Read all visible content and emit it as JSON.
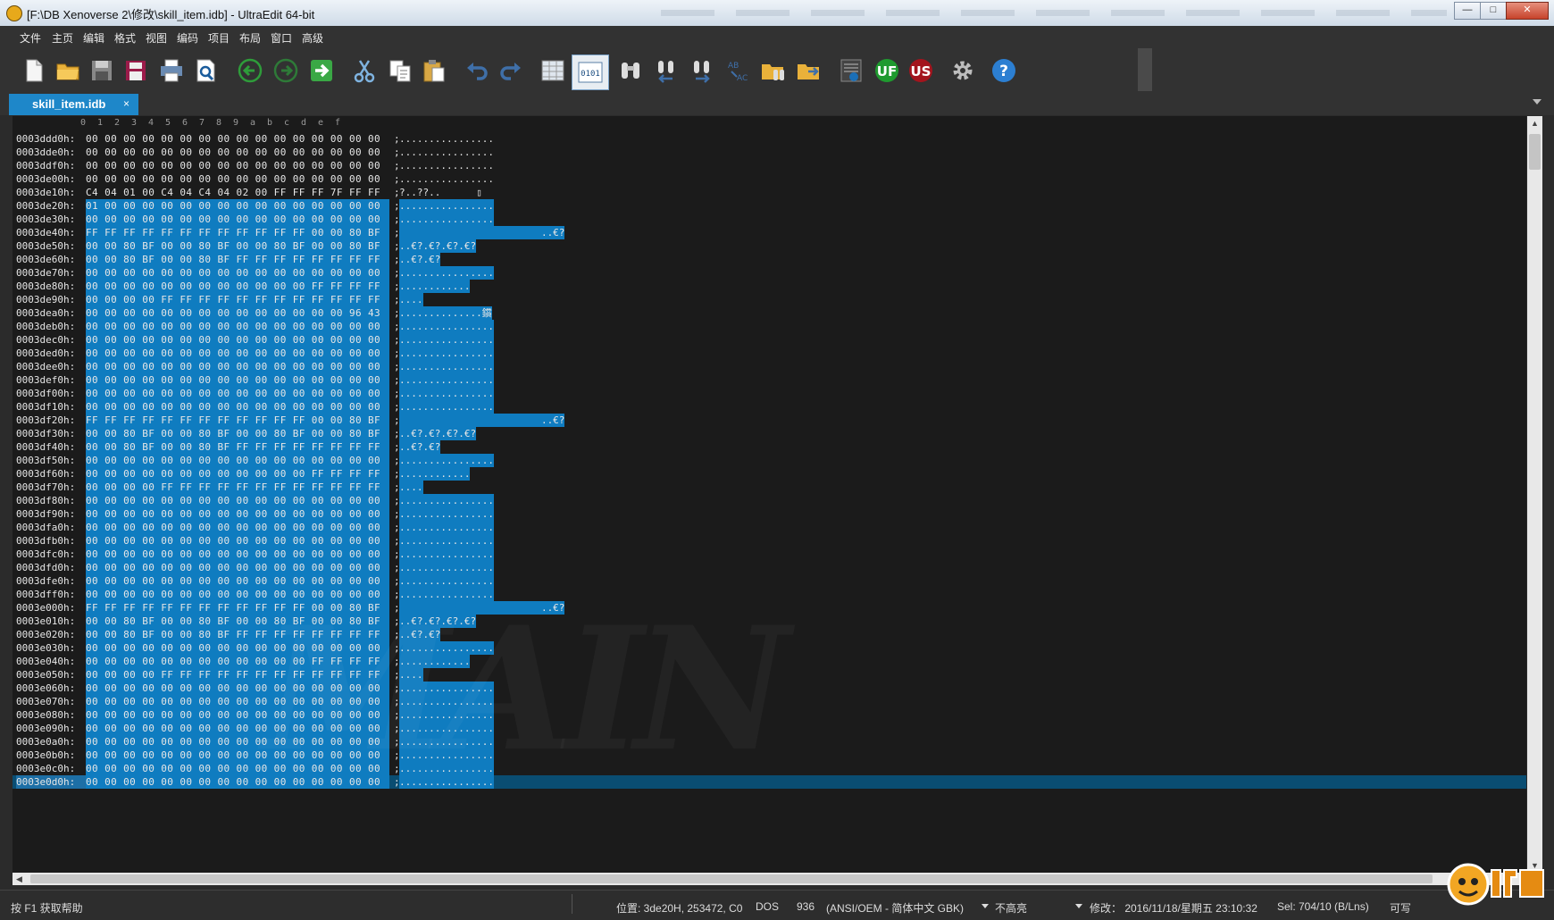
{
  "window": {
    "title": "[F:\\DB Xenoverse 2\\修改\\skill_item.idb] - UltraEdit 64-bit",
    "minimize_label": "—",
    "maximize_label": "□",
    "close_label": "✕"
  },
  "menu": [
    "文件",
    "主页",
    "编辑",
    "格式",
    "视图",
    "编码",
    "项目",
    "布局",
    "窗口",
    "高级"
  ],
  "toolbar": {
    "buttons": [
      "new-file",
      "open-folder",
      "save",
      "save-as",
      "print",
      "print-preview",
      "back",
      "forward",
      "go-to",
      "cut",
      "copy",
      "paste",
      "undo",
      "redo",
      "column-mode",
      "hex-mode",
      "find",
      "find-prev",
      "find-next",
      "replace",
      "find-in-files",
      "replace-in-files",
      "ftp-browser",
      "uestudio",
      "uninstall-ultraedit",
      "settings",
      "help"
    ],
    "hex_mode_label": "0101"
  },
  "tab": {
    "label": "skill_item.idb",
    "close": "×"
  },
  "ruler": [
    "0",
    "1",
    "2",
    "3",
    "4",
    "5",
    "6",
    "7",
    "8",
    "9",
    "a",
    "b",
    "c",
    "d",
    "e",
    "f"
  ],
  "rows": [
    {
      "addr": "0003ddd0h:",
      "hex": "00 00 00 00 00 00 00 00 00 00 00 00 00 00 00 00",
      "ascii": "................"
    },
    {
      "addr": "0003dde0h:",
      "hex": "00 00 00 00 00 00 00 00 00 00 00 00 00 00 00 00",
      "ascii": "................"
    },
    {
      "addr": "0003ddf0h:",
      "hex": "00 00 00 00 00 00 00 00 00 00 00 00 00 00 00 00",
      "ascii": "................"
    },
    {
      "addr": "0003de00h:",
      "hex": "00 00 00 00 00 00 00 00 00 00 00 00 00 00 00 00",
      "ascii": "................"
    },
    {
      "addr": "0003de10h:",
      "hex": "C4 04 01 00 C4 04 C4 04 02 00 FF FF FF 7F FF FF",
      "ascii": "?..??..      ▯"
    },
    {
      "addr": "0003de20h:",
      "hex": "01 00 00 00 00 00 00 00 00 00 00 00 00 00 00 00",
      "ascii": "................"
    },
    {
      "addr": "0003de30h:",
      "hex": "00 00 00 00 00 00 00 00 00 00 00 00 00 00 00 00",
      "ascii": "................"
    },
    {
      "addr": "0003de40h:",
      "hex": "FF FF FF FF FF FF FF FF FF FF FF FF 00 00 80 BF",
      "ascii": "                        ..€?"
    },
    {
      "addr": "0003de50h:",
      "hex": "00 00 80 BF 00 00 80 BF 00 00 80 BF 00 00 80 BF",
      "ascii": "..€?.€?.€?.€?"
    },
    {
      "addr": "0003de60h:",
      "hex": "00 00 80 BF 00 00 80 BF FF FF FF FF FF FF FF FF",
      "ascii": "..€?.€?"
    },
    {
      "addr": "0003de70h:",
      "hex": "00 00 00 00 00 00 00 00 00 00 00 00 00 00 00 00",
      "ascii": "................"
    },
    {
      "addr": "0003de80h:",
      "hex": "00 00 00 00 00 00 00 00 00 00 00 00 FF FF FF FF",
      "ascii": "............"
    },
    {
      "addr": "0003de90h:",
      "hex": "00 00 00 00 FF FF FF FF FF FF FF FF FF FF FF FF",
      "ascii": "...."
    },
    {
      "addr": "0003dea0h:",
      "hex": "00 00 00 00 00 00 00 00 00 00 00 00 00 00 96 43",
      "ascii": "..............鑜"
    },
    {
      "addr": "0003deb0h:",
      "hex": "00 00 00 00 00 00 00 00 00 00 00 00 00 00 00 00",
      "ascii": "................"
    },
    {
      "addr": "0003dec0h:",
      "hex": "00 00 00 00 00 00 00 00 00 00 00 00 00 00 00 00",
      "ascii": "................"
    },
    {
      "addr": "0003ded0h:",
      "hex": "00 00 00 00 00 00 00 00 00 00 00 00 00 00 00 00",
      "ascii": "................"
    },
    {
      "addr": "0003dee0h:",
      "hex": "00 00 00 00 00 00 00 00 00 00 00 00 00 00 00 00",
      "ascii": "................"
    },
    {
      "addr": "0003def0h:",
      "hex": "00 00 00 00 00 00 00 00 00 00 00 00 00 00 00 00",
      "ascii": "................"
    },
    {
      "addr": "0003df00h:",
      "hex": "00 00 00 00 00 00 00 00 00 00 00 00 00 00 00 00",
      "ascii": "................"
    },
    {
      "addr": "0003df10h:",
      "hex": "00 00 00 00 00 00 00 00 00 00 00 00 00 00 00 00",
      "ascii": "................"
    },
    {
      "addr": "0003df20h:",
      "hex": "FF FF FF FF FF FF FF FF FF FF FF FF 00 00 80 BF",
      "ascii": "                        ..€?"
    },
    {
      "addr": "0003df30h:",
      "hex": "00 00 80 BF 00 00 80 BF 00 00 80 BF 00 00 80 BF",
      "ascii": "..€?.€?.€?.€?"
    },
    {
      "addr": "0003df40h:",
      "hex": "00 00 80 BF 00 00 80 BF FF FF FF FF FF FF FF FF",
      "ascii": "..€?.€?"
    },
    {
      "addr": "0003df50h:",
      "hex": "00 00 00 00 00 00 00 00 00 00 00 00 00 00 00 00",
      "ascii": "................"
    },
    {
      "addr": "0003df60h:",
      "hex": "00 00 00 00 00 00 00 00 00 00 00 00 FF FF FF FF",
      "ascii": "............"
    },
    {
      "addr": "0003df70h:",
      "hex": "00 00 00 00 FF FF FF FF FF FF FF FF FF FF FF FF",
      "ascii": "...."
    },
    {
      "addr": "0003df80h:",
      "hex": "00 00 00 00 00 00 00 00 00 00 00 00 00 00 00 00",
      "ascii": "................"
    },
    {
      "addr": "0003df90h:",
      "hex": "00 00 00 00 00 00 00 00 00 00 00 00 00 00 00 00",
      "ascii": "................"
    },
    {
      "addr": "0003dfa0h:",
      "hex": "00 00 00 00 00 00 00 00 00 00 00 00 00 00 00 00",
      "ascii": "................"
    },
    {
      "addr": "0003dfb0h:",
      "hex": "00 00 00 00 00 00 00 00 00 00 00 00 00 00 00 00",
      "ascii": "................"
    },
    {
      "addr": "0003dfc0h:",
      "hex": "00 00 00 00 00 00 00 00 00 00 00 00 00 00 00 00",
      "ascii": "................"
    },
    {
      "addr": "0003dfd0h:",
      "hex": "00 00 00 00 00 00 00 00 00 00 00 00 00 00 00 00",
      "ascii": "................"
    },
    {
      "addr": "0003dfe0h:",
      "hex": "00 00 00 00 00 00 00 00 00 00 00 00 00 00 00 00",
      "ascii": "................"
    },
    {
      "addr": "0003dff0h:",
      "hex": "00 00 00 00 00 00 00 00 00 00 00 00 00 00 00 00",
      "ascii": "................"
    },
    {
      "addr": "0003e000h:",
      "hex": "FF FF FF FF FF FF FF FF FF FF FF FF 00 00 80 BF",
      "ascii": "                        ..€?"
    },
    {
      "addr": "0003e010h:",
      "hex": "00 00 80 BF 00 00 80 BF 00 00 80 BF 00 00 80 BF",
      "ascii": "..€?.€?.€?.€?"
    },
    {
      "addr": "0003e020h:",
      "hex": "00 00 80 BF 00 00 80 BF FF FF FF FF FF FF FF FF",
      "ascii": "..€?.€?"
    },
    {
      "addr": "0003e030h:",
      "hex": "00 00 00 00 00 00 00 00 00 00 00 00 00 00 00 00",
      "ascii": "................"
    },
    {
      "addr": "0003e040h:",
      "hex": "00 00 00 00 00 00 00 00 00 00 00 00 FF FF FF FF",
      "ascii": "............"
    },
    {
      "addr": "0003e050h:",
      "hex": "00 00 00 00 FF FF FF FF FF FF FF FF FF FF FF FF",
      "ascii": "...."
    },
    {
      "addr": "0003e060h:",
      "hex": "00 00 00 00 00 00 00 00 00 00 00 00 00 00 00 00",
      "ascii": "................"
    },
    {
      "addr": "0003e070h:",
      "hex": "00 00 00 00 00 00 00 00 00 00 00 00 00 00 00 00",
      "ascii": "................"
    },
    {
      "addr": "0003e080h:",
      "hex": "00 00 00 00 00 00 00 00 00 00 00 00 00 00 00 00",
      "ascii": "................"
    },
    {
      "addr": "0003e090h:",
      "hex": "00 00 00 00 00 00 00 00 00 00 00 00 00 00 00 00",
      "ascii": "................"
    },
    {
      "addr": "0003e0a0h:",
      "hex": "00 00 00 00 00 00 00 00 00 00 00 00 00 00 00 00",
      "ascii": "................"
    },
    {
      "addr": "0003e0b0h:",
      "hex": "00 00 00 00 00 00 00 00 00 00 00 00 00 00 00 00",
      "ascii": "................"
    },
    {
      "addr": "0003e0c0h:",
      "hex": "00 00 00 00 00 00 00 00 00 00 00 00 00 00 00 00",
      "ascii": "................"
    },
    {
      "addr": "0003e0d0h:",
      "hex": "00 00 00 00 00 00 00 00 00 00 00 00 00 00 00 00",
      "ascii": "................"
    }
  ],
  "status": {
    "help": "按 F1 获取帮助",
    "position": "位置: 3de20H, 253472, C0",
    "line_ending": "DOS",
    "codepage": "936",
    "encoding": "(ANSI/OEM - 简体中文 GBK)",
    "highlight": "不高亮",
    "modified": "修改： 2016/11/18/星期五 23:10:32",
    "selection": "Sel: 704/10 (B/Lns)",
    "mode": "可写"
  },
  "colors": {
    "selection": "#0f7cc0",
    "current_line": "#0a4d72",
    "tab": "#1e87c9"
  }
}
